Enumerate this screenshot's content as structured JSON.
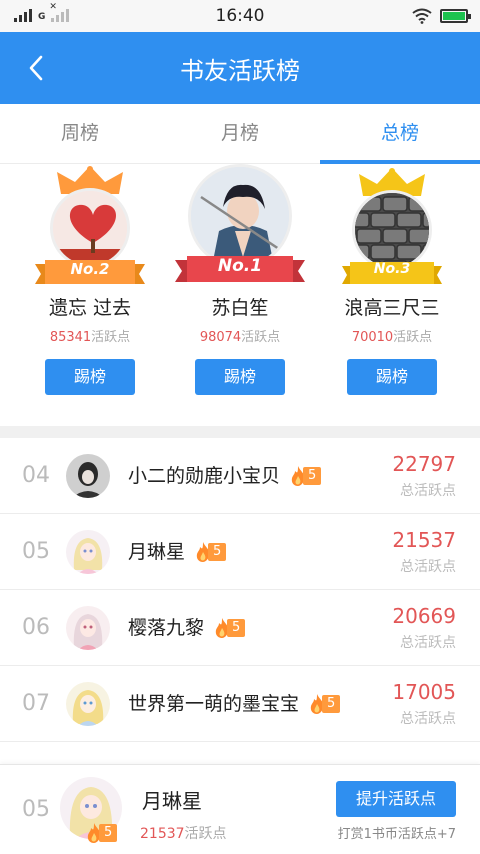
{
  "status_bar": {
    "time": "16:40",
    "network_label": "G",
    "no_signal_mark": "✕"
  },
  "header": {
    "title": "书友活跃榜",
    "back_icon": "chevron-left-icon"
  },
  "tabs": [
    {
      "label": "周榜",
      "active": false
    },
    {
      "label": "月榜",
      "active": false
    },
    {
      "label": "总榜",
      "active": true
    }
  ],
  "podium": {
    "points_suffix": "活跃点",
    "kick_label": "踢榜",
    "entries": [
      {
        "badge": "No.2",
        "name": "遗忘   过去",
        "points": "85341"
      },
      {
        "badge": "No.1",
        "name": "苏白笙",
        "points": "98074"
      },
      {
        "badge": "No.3",
        "name": "浪高三尺三",
        "points": "70010"
      }
    ]
  },
  "list": {
    "score_label": "总活跃点",
    "rows": [
      {
        "rank": "04",
        "name": "小二的勋鹿小宝贝",
        "level": "5",
        "score": "22797"
      },
      {
        "rank": "05",
        "name": "月琳星",
        "level": "5",
        "score": "21537"
      },
      {
        "rank": "06",
        "name": "樱落九黎",
        "level": "5",
        "score": "20669"
      },
      {
        "rank": "07",
        "name": "世界第一萌的墨宝宝",
        "level": "5",
        "score": "17005"
      }
    ]
  },
  "me": {
    "rank": "05",
    "name": "月琳星",
    "level": "5",
    "points": "21537",
    "points_suffix": "活跃点",
    "boost_label": "提升活跃点",
    "hint": "打赏1书币活跃点+7"
  },
  "colors": {
    "primary": "#2f8ff0",
    "score_red": "#e25656",
    "level_orange": "#ff9a3c",
    "gold": "#f5a623",
    "crown_red": "#e8464c"
  }
}
